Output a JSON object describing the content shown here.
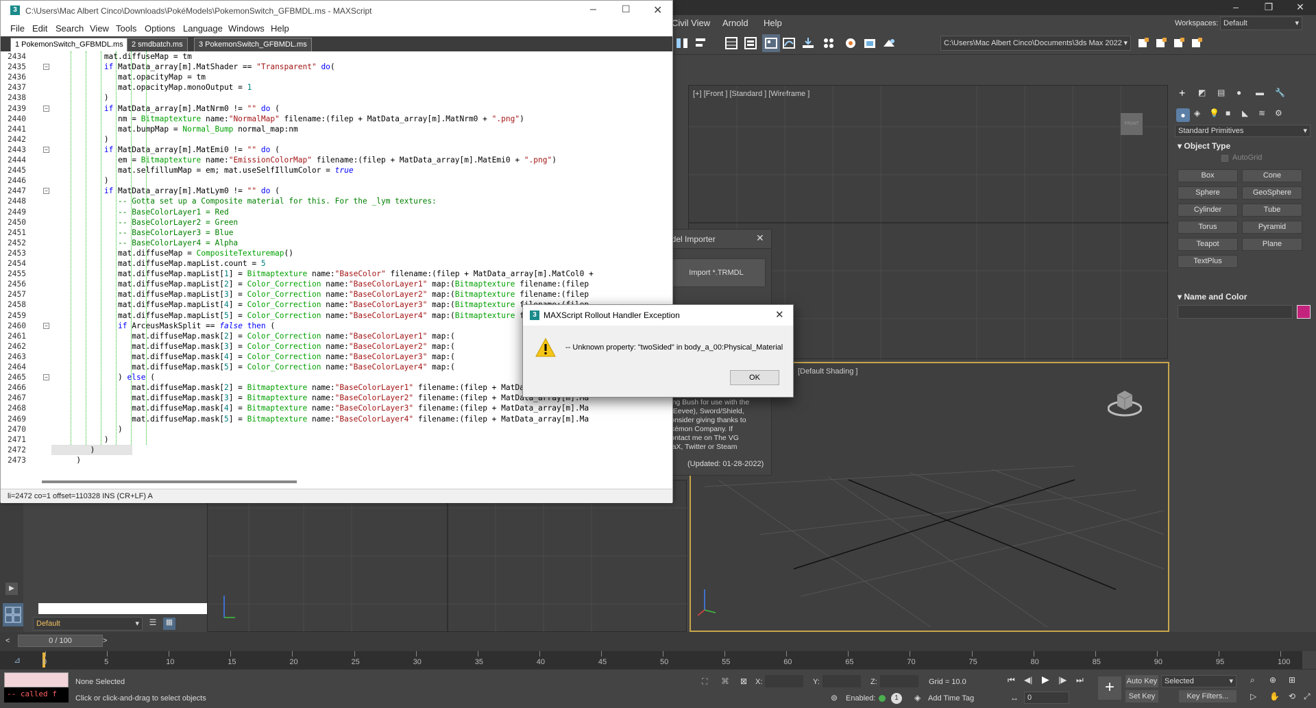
{
  "editor": {
    "title": "C:\\Users\\Mac Albert Cinco\\Downloads\\PokéModels\\PokemonSwitch_GFBMDL.ms - MAXScript",
    "menu": [
      "File",
      "Edit",
      "Search",
      "View",
      "Tools",
      "Options",
      "Language",
      "Windows",
      "Help"
    ],
    "tabs": [
      "1 PokemonSwitch_GFBMDL.ms",
      "2 smdbatch.ms",
      "3 PokemonSwitch_GFBMDL.ms"
    ],
    "active_tab": 2,
    "status": "li=2472 co=1 offset=110328 INS (CR+LF) A",
    "lines": [
      {
        "n": "2434",
        "code": "            mat.diffuseMap = tm"
      },
      {
        "n": "2435",
        "code": "            if MatData_array[m].MatShader == \"Transparent\" do("
      },
      {
        "n": "2436",
        "code": "               mat.opacityMap = tm"
      },
      {
        "n": "2437",
        "code": "               mat.opacityMap.monoOutput = 1"
      },
      {
        "n": "2438",
        "code": "            )"
      },
      {
        "n": "2439",
        "code": "            if MatData_array[m].MatNrm0 != \"\" do ("
      },
      {
        "n": "2440",
        "code": "               nm = Bitmaptexture name:\"NormalMap\" filename:(filep + MatData_array[m].MatNrm0 + \".png\")"
      },
      {
        "n": "2441",
        "code": "               mat.bumpMap = Normal_Bump normal_map:nm"
      },
      {
        "n": "2442",
        "code": "            )"
      },
      {
        "n": "2443",
        "code": "            if MatData_array[m].MatEmi0 != \"\" do ("
      },
      {
        "n": "2444",
        "code": "               em = Bitmaptexture name:\"EmissionColorMap\" filename:(filep + MatData_array[m].MatEmi0 + \".png\")"
      },
      {
        "n": "2445",
        "code": "               mat.selfillumMap = em; mat.useSelfIllumColor = true"
      },
      {
        "n": "2446",
        "code": "            )"
      },
      {
        "n": "2447",
        "code": "            if MatData_array[m].MatLym0 != \"\" do ("
      },
      {
        "n": "2448",
        "code": "               -- Gotta set up a Composite material for this. For the _lym textures:"
      },
      {
        "n": "2449",
        "code": "               -- BaseColorLayer1 = Red"
      },
      {
        "n": "2450",
        "code": "               -- BaseColorLayer2 = Green"
      },
      {
        "n": "2451",
        "code": "               -- BaseColorLayer3 = Blue"
      },
      {
        "n": "2452",
        "code": "               -- BaseColorLayer4 = Alpha"
      },
      {
        "n": "2453",
        "code": "               mat.diffuseMap = CompositeTexturemap()"
      },
      {
        "n": "2454",
        "code": "               mat.diffuseMap.mapList.count = 5"
      },
      {
        "n": "2455",
        "code": "               mat.diffuseMap.mapList[1] = Bitmaptexture name:\"BaseColor\" filename:(filep + MatData_array[m].MatCol0 +"
      },
      {
        "n": "2456",
        "code": "               mat.diffuseMap.mapList[2] = Color_Correction name:\"BaseColorLayer1\" map:(Bitmaptexture filename:(filep"
      },
      {
        "n": "2457",
        "code": "               mat.diffuseMap.mapList[3] = Color_Correction name:\"BaseColorLayer2\" map:(Bitmaptexture filename:(filep"
      },
      {
        "n": "2458",
        "code": "               mat.diffuseMap.mapList[4] = Color_Correction name:\"BaseColorLayer3\" map:(Bitmaptexture filename:(filep"
      },
      {
        "n": "2459",
        "code": "               mat.diffuseMap.mapList[5] = Color_Correction name:\"BaseColorLayer4\" map:(Bitmaptexture filename:(filep"
      },
      {
        "n": "2460",
        "code": "               if ArceusMaskSplit == false then ("
      },
      {
        "n": "2461",
        "code": "                  mat.diffuseMap.mask[2] = Color_Correction name:\"BaseColorLayer1\" map:("
      },
      {
        "n": "2462",
        "code": "                  mat.diffuseMap.mask[3] = Color_Correction name:\"BaseColorLayer2\" map:("
      },
      {
        "n": "2463",
        "code": "                  mat.diffuseMap.mask[4] = Color_Correction name:\"BaseColorLayer3\" map:("
      },
      {
        "n": "2464",
        "code": "                  mat.diffuseMap.mask[5] = Color_Correction name:\"BaseColorLayer4\" map:("
      },
      {
        "n": "2465",
        "code": "               ) else ("
      },
      {
        "n": "2466",
        "code": "                  mat.diffuseMap.mask[2] = Bitmaptexture name:\"BaseColorLayer1\" filename:(filep + MatData_array[m].Ma"
      },
      {
        "n": "2467",
        "code": "                  mat.diffuseMap.mask[3] = Bitmaptexture name:\"BaseColorLayer2\" filename:(filep + MatData_array[m].Ma"
      },
      {
        "n": "2468",
        "code": "                  mat.diffuseMap.mask[4] = Bitmaptexture name:\"BaseColorLayer3\" filename:(filep + MatData_array[m].Ma"
      },
      {
        "n": "2469",
        "code": "                  mat.diffuseMap.mask[5] = Bitmaptexture name:\"BaseColorLayer4\" filename:(filep + MatData_array[m].Ma"
      },
      {
        "n": "2470",
        "code": "               )"
      },
      {
        "n": "2471",
        "code": "            )"
      },
      {
        "n": "2472",
        "code": "         )"
      },
      {
        "n": "2473",
        "code": "      )"
      }
    ]
  },
  "max": {
    "menu": [
      "Civil View",
      "Arnold",
      "Help"
    ],
    "workspaces_label": "Workspaces:",
    "workspace_value": "Default",
    "project_path": "C:\\Users\\Mac Albert Cinco\\Documents\\3ds Max 2022",
    "viewport_front_label": "[+] [Front ] [Standard ] [Wireframe ]",
    "viewport_persp_label": "[Default Shading ]",
    "viewcube_front": "FRONT",
    "command_panel": {
      "category": "Standard Primitives",
      "object_type": "Object Type",
      "autogrid": "AutoGrid",
      "buttons": [
        "Box",
        "Cone",
        "Sphere",
        "GeoSphere",
        "Cylinder",
        "Tube",
        "Torus",
        "Pyramid",
        "Teapot",
        "Plane",
        "TextPlus"
      ],
      "name_and_color": "Name and Color",
      "swatch_color": "#c4237d"
    },
    "scene_explorer": {
      "layer": "Default"
    },
    "timeline": {
      "frame": "0 / 100",
      "ticks": [
        "0",
        "5",
        "10",
        "15",
        "20",
        "25",
        "30",
        "35",
        "40",
        "45",
        "50",
        "55",
        "60",
        "65",
        "70",
        "75",
        "80",
        "85",
        "90",
        "95",
        "100"
      ]
    },
    "status": {
      "selection": "None Selected",
      "prompt": "Click or click-and-drag to select objects",
      "listener": "-- called f",
      "x_label": "X:",
      "y_label": "Y:",
      "z_label": "Z:",
      "grid": "Grid = 10.0",
      "enabled": "Enabled:",
      "add_time_tag": "Add Time Tag",
      "auto_key": "Auto Key",
      "set_key": "Set Key",
      "selected": "Selected",
      "key_filters": "Key Filters...",
      "frame_field": "0"
    },
    "importer": {
      "title": "Model Importer",
      "button": "Import *.TRMDL",
      "text_lines": [
        "king Bush for use with the",
        "u/Eevee), Sword/Shield,",
        "consider giving thanks to",
        "okémon Company. If",
        "contact me on The VG",
        "iTaX, Twitter or Steam"
      ],
      "updated": "(Updated: 01-28-2022)"
    }
  },
  "dialog": {
    "title": "MAXScript Rollout Handler Exception",
    "message": "-- Unknown property: \"twoSided\" in body_a_00:Physical_Material",
    "ok": "OK"
  }
}
